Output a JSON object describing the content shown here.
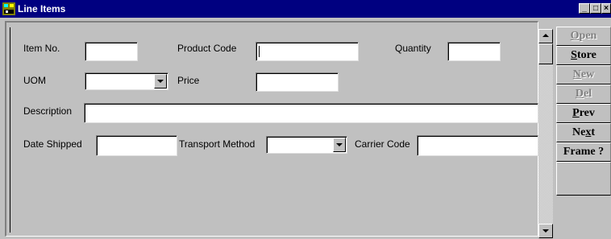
{
  "window": {
    "title": "Line Items",
    "min_glyph": "_",
    "max_glyph": "□",
    "close_glyph": "×"
  },
  "form": {
    "item_no": {
      "label": "Item No.",
      "value": ""
    },
    "product_code": {
      "label": "Product Code",
      "value": ""
    },
    "quantity": {
      "label": "Quantity",
      "value": ""
    },
    "uom": {
      "label": "UOM",
      "value": ""
    },
    "price": {
      "label": "Price",
      "value": ""
    },
    "description": {
      "label": "Description",
      "value": ""
    },
    "date_shipped": {
      "label": "Date Shipped",
      "value": ""
    },
    "transport_method": {
      "label": "Transport Method",
      "value": ""
    },
    "carrier_code": {
      "label": "Carrier Code",
      "value": ""
    }
  },
  "buttons": [
    {
      "name": "open-button",
      "pre": "",
      "ul": "O",
      "post": "pen",
      "enabled": false
    },
    {
      "name": "store-button",
      "pre": "",
      "ul": "S",
      "post": "tore",
      "enabled": true
    },
    {
      "name": "new-button",
      "pre": "",
      "ul": "N",
      "post": "ew",
      "enabled": false
    },
    {
      "name": "del-button",
      "pre": "",
      "ul": "D",
      "post": "el",
      "enabled": false
    },
    {
      "name": "prev-button",
      "pre": "",
      "ul": "P",
      "post": "rev",
      "enabled": true
    },
    {
      "name": "next-button",
      "pre": "Ne",
      "ul": "x",
      "post": "t",
      "enabled": true
    },
    {
      "name": "frame-button",
      "pre": "Frame ?",
      "ul": "",
      "post": "",
      "enabled": true
    }
  ]
}
